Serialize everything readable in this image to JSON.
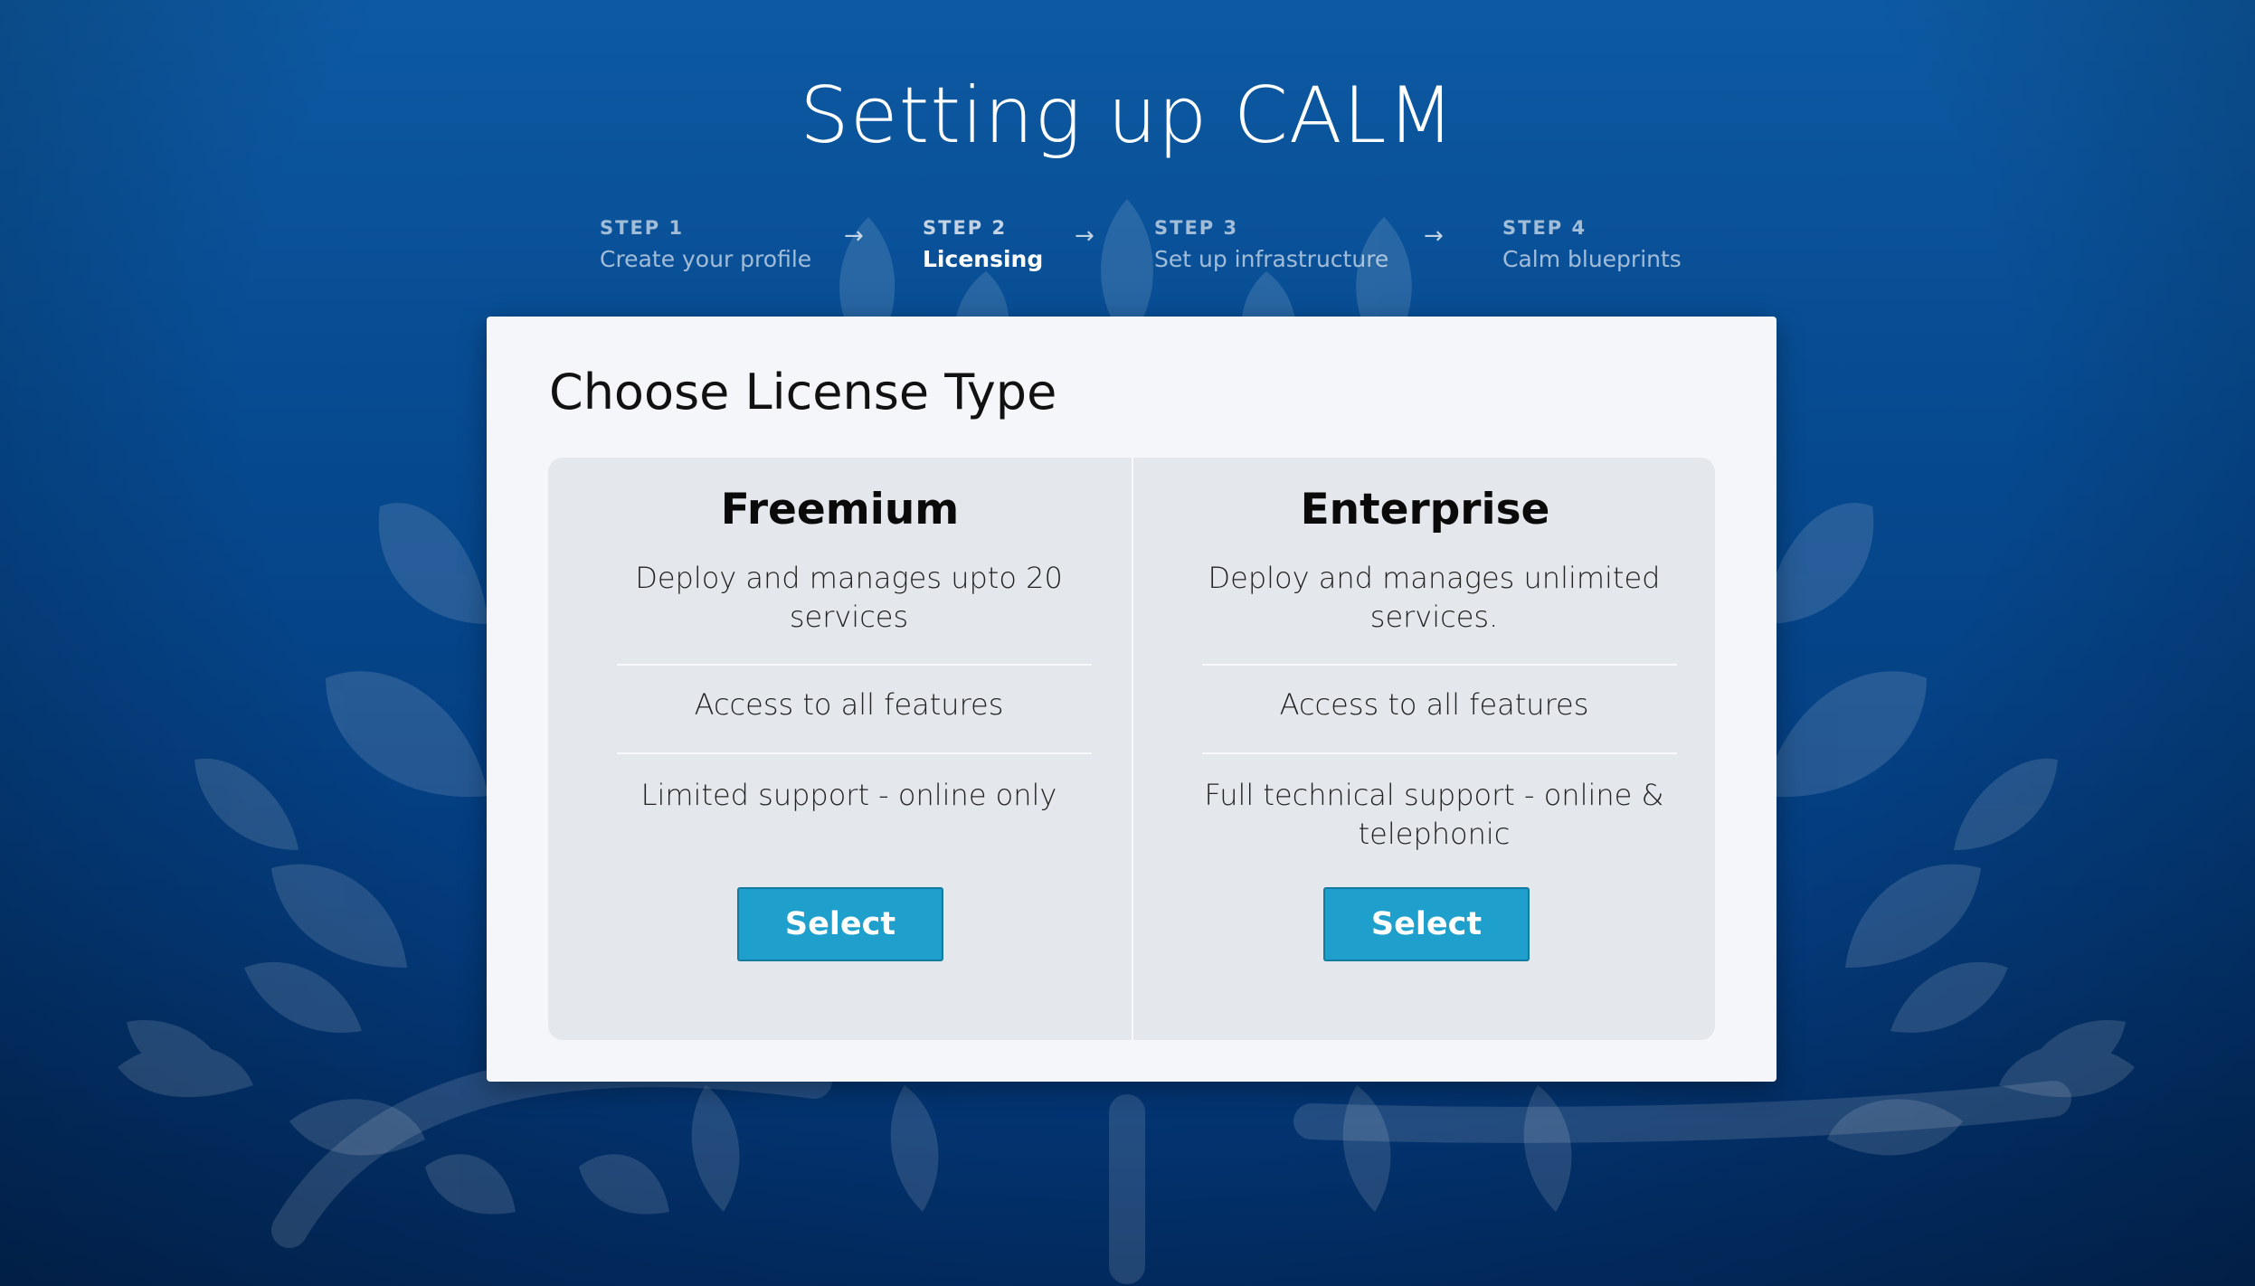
{
  "header": {
    "title": "Setting up CALM"
  },
  "steps": [
    {
      "number": "STEP 1",
      "label": "Create your profile",
      "active": false
    },
    {
      "number": "STEP 2",
      "label": "Licensing",
      "active": true
    },
    {
      "number": "STEP 3",
      "label": "Set up infrastructure",
      "active": false
    },
    {
      "number": "STEP 4",
      "label": "Calm blueprints",
      "active": false
    }
  ],
  "step_arrow_glyph": "→",
  "modal": {
    "title": "Choose License Type",
    "plans": [
      {
        "name": "Freemium",
        "features": [
          "Deploy and manages upto 20 services",
          "Access to all features",
          "Limited support - online only"
        ],
        "button_label": "Select"
      },
      {
        "name": "Enterprise",
        "features": [
          "Deploy and manages unlimited services.",
          "Access to all features",
          "Full technical support - online & telephonic"
        ],
        "button_label": "Select"
      }
    ]
  },
  "colors": {
    "background_top": "#0d5aa3",
    "background_bottom": "#022f6a",
    "button": "#1fa0cc",
    "card": "#f4f6f9",
    "plan_panel": "#e4e7eb"
  }
}
